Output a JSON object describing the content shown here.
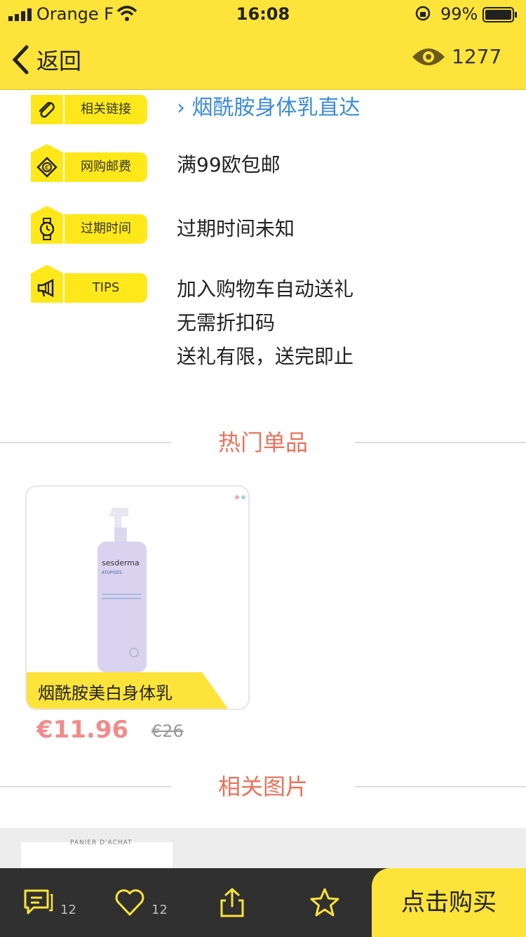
{
  "status_bar": {
    "carrier": "Orange F",
    "time": "16:08",
    "battery": "99%"
  },
  "nav": {
    "back_label": "返回",
    "view_count": "1277"
  },
  "info": {
    "link": {
      "label": "相关链接",
      "value": "烟酰胺身体乳直达",
      "chevron": "›"
    },
    "shipping": {
      "label": "网购邮费",
      "value": "满99欧包邮"
    },
    "expiry": {
      "label": "过期时间",
      "value": "过期时间未知"
    },
    "tips": {
      "label": "TIPS",
      "lines": [
        "加入购物车自动送礼",
        "无需折扣码",
        "送礼有限，送完即止"
      ]
    }
  },
  "sections": {
    "hot": "热门单品",
    "photos": "相关图片"
  },
  "product": {
    "name": "烟酰胺美白身体乳",
    "price": "€11.96",
    "original_price": "€26",
    "brand": "sesderma",
    "line": "ATOPISES"
  },
  "photo_strip": {
    "thumb_caption": "PANIER D'ACHAT"
  },
  "tabbar": {
    "comments_count": "12",
    "likes_count": "12",
    "buy_label": "点击购买"
  },
  "colors": {
    "accent_yellow": "#fde33a",
    "tag_yellow": "#ffe81a",
    "section_title": "#e8735b",
    "link_blue": "#3b8bd8",
    "price_pink": "#f08c8c",
    "tabbar_dark": "#303030"
  }
}
